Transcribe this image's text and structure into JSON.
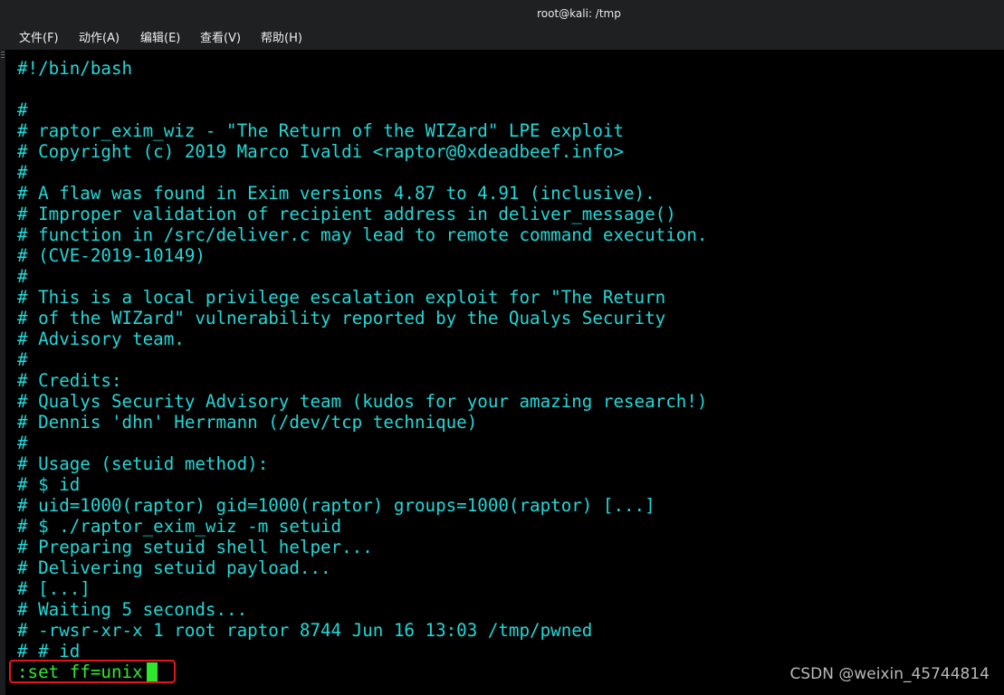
{
  "window": {
    "title": "root@kali: /tmp"
  },
  "menubar": {
    "items": [
      {
        "label": "文件(F)"
      },
      {
        "label": "动作(A)"
      },
      {
        "label": "编辑(E)"
      },
      {
        "label": "查看(V)"
      },
      {
        "label": "帮助(H)"
      }
    ]
  },
  "terminal": {
    "lines": [
      "#!/bin/bash",
      "",
      "#",
      "# raptor_exim_wiz - \"The Return of the WIZard\" LPE exploit",
      "# Copyright (c) 2019 Marco Ivaldi <raptor@0xdeadbeef.info>",
      "#",
      "# A flaw was found in Exim versions 4.87 to 4.91 (inclusive).",
      "# Improper validation of recipient address in deliver_message()",
      "# function in /src/deliver.c may lead to remote command execution.",
      "# (CVE-2019-10149)",
      "#",
      "# This is a local privilege escalation exploit for \"The Return",
      "# of the WIZard\" vulnerability reported by the Qualys Security",
      "# Advisory team.",
      "#",
      "# Credits:",
      "# Qualys Security Advisory team (kudos for your amazing research!)",
      "# Dennis 'dhn' Herrmann (/dev/tcp technique)",
      "#",
      "# Usage (setuid method):",
      "# $ id",
      "# uid=1000(raptor) gid=1000(raptor) groups=1000(raptor) [...]",
      "# $ ./raptor_exim_wiz -m setuid",
      "# Preparing setuid shell helper...",
      "# Delivering setuid payload...",
      "# [...]",
      "# Waiting 5 seconds...",
      "# -rwsr-xr-x 1 root raptor 8744 Jun 16 13:03 /tmp/pwned",
      "# # id"
    ],
    "command_line": ":set ff=unix"
  },
  "watermark": {
    "text": "CSDN @weixin_45744814"
  },
  "colors": {
    "terminal_text": "#21d8d8",
    "command_text": "#2ee82e",
    "highlight_box": "#e5141b",
    "background": "#000000"
  }
}
